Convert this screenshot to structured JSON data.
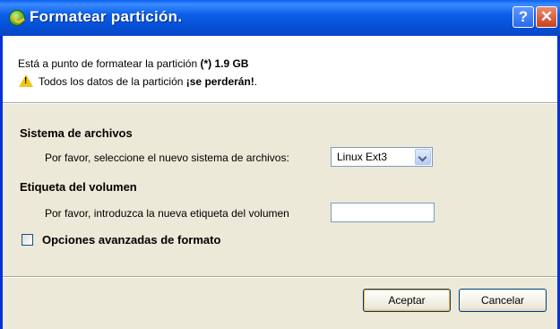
{
  "window": {
    "title": "Formatear partición.",
    "help_label": "?",
    "close_label": "✕"
  },
  "info": {
    "line1_text": "Está a punto de formatear la partición ",
    "line1_partition": "(*) 1.9 GB",
    "line2_text": "Todos los datos de la partición ",
    "line2_bold": "¡se perderán!",
    "line2_end": ".",
    "warning_mark": "!"
  },
  "filesystem": {
    "heading": "Sistema de archivos",
    "prompt": "Por favor, seleccione el nuevo sistema de archivos:",
    "selected": "Linux Ext3"
  },
  "volume": {
    "heading": "Etiqueta del volumen",
    "prompt": "Por favor, introduzca la nueva etiqueta del volumen",
    "value": ""
  },
  "advanced": {
    "label": "Opciones avanzadas de formato",
    "checked": false
  },
  "buttons": {
    "ok": "Aceptar",
    "cancel": "Cancelar"
  },
  "colors": {
    "titlebar": "#0651d8",
    "dialog_bg": "#ece9d8",
    "warning": "#f2c418"
  },
  "icons": [
    "app-icon",
    "help-icon",
    "close-icon",
    "warning-icon",
    "dropdown-arrow-icon"
  ]
}
